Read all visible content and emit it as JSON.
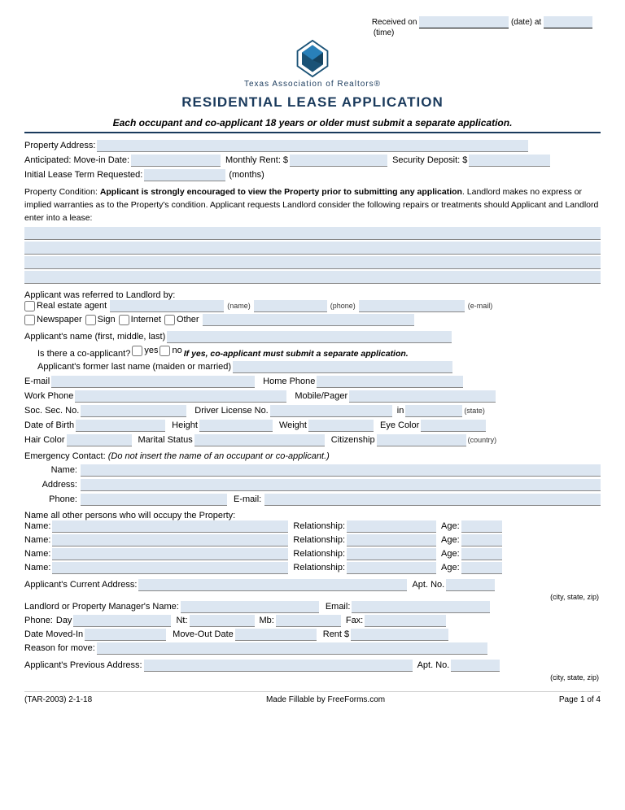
{
  "header": {
    "received_label": "Received on",
    "date_at_label": "(date) at",
    "time_label": "(time)",
    "org_name": "Texas Association of Realtors",
    "org_trademark": "®",
    "form_title": "RESIDENTIAL LEASE APPLICATION",
    "subtitle": "Each occupant and co-applicant 18 years or older must submit a separate application."
  },
  "property_section": {
    "address_label": "Property Address:",
    "move_in_label": "Anticipated:  Move-in Date:",
    "monthly_rent_label": "Monthly Rent: $",
    "security_deposit_label": "Security Deposit: $",
    "lease_term_label": "Initial Lease Term Requested:",
    "lease_term_unit": "(months)"
  },
  "condition_section": {
    "text_start": "Property Condition: ",
    "bold_text": "Applicant is strongly encouraged to view the Property prior to submitting any application",
    "text_end": ". Landlord makes no express or implied warranties as to the Property's condition. Applicant requests Landlord consider the following repairs or treatments should Applicant and Landlord enter into a lease:"
  },
  "referred_section": {
    "label": "Applicant was referred to Landlord by:",
    "real_estate_label": "Real estate agent",
    "name_label": "(name)",
    "phone_label": "(phone)",
    "email_label": "(e-mail)",
    "newspaper_label": "Newspaper",
    "sign_label": "Sign",
    "internet_label": "Internet",
    "other_label": "Other"
  },
  "applicant_section": {
    "name_label": "Applicant's name (first, middle, last)",
    "co_applicant_label": "Is there a co-applicant?",
    "yes_label": "yes",
    "no_label": "no",
    "co_note": "If yes, co-applicant must submit a separate application.",
    "former_name_label": "Applicant's former last name (maiden or married)",
    "email_label": "E-mail",
    "home_phone_label": "Home Phone",
    "work_phone_label": "Work Phone",
    "mobile_label": "Mobile/Pager",
    "soc_sec_label": "Soc. Sec. No.",
    "driver_license_label": "Driver License No.",
    "in_label": "in",
    "state_label": "(state)",
    "dob_label": "Date of Birth",
    "height_label": "Height",
    "weight_label": "Weight",
    "eye_color_label": "Eye Color",
    "hair_color_label": "Hair Color",
    "marital_status_label": "Marital Status",
    "citizenship_label": "Citizenship",
    "country_label": "(country)"
  },
  "emergency_section": {
    "label": "Emergency Contact:",
    "note": "(Do not insert the name of an occupant or co-applicant.)",
    "name_label": "Name:",
    "address_label": "Address:",
    "phone_label": "Phone:",
    "email_label": "E-mail:"
  },
  "occupants_section": {
    "label": "Name all other persons who will occupy the Property:",
    "rows": [
      {
        "name_label": "Name:",
        "rel_label": "Relationship:",
        "age_label": "Age:"
      },
      {
        "name_label": "Name:",
        "rel_label": "Relationship:",
        "age_label": "Age:"
      },
      {
        "name_label": "Name:",
        "rel_label": "Relationship:",
        "age_label": "Age:"
      },
      {
        "name_label": "Name:",
        "rel_label": "Relationship:",
        "age_label": "Age:"
      }
    ]
  },
  "current_address_section": {
    "label": "Applicant's Current Address:",
    "apt_label": "Apt. No.",
    "city_state_zip_label": "(city, state, zip)",
    "landlord_label": "Landlord or Property Manager's Name:",
    "email_label": "Email:",
    "phone_label": "Phone:",
    "day_label": "Day",
    "nt_label": "Nt:",
    "mb_label": "Mb:",
    "fax_label": "Fax:",
    "moved_in_label": "Date Moved-In",
    "move_out_label": "Move-Out Date",
    "rent_label": "Rent $",
    "reason_label": "Reason for move:"
  },
  "previous_address_section": {
    "label": "Applicant's Previous Address:",
    "apt_label": "Apt. No.",
    "city_state_zip_label": "(city, state, zip)"
  },
  "footer": {
    "form_code": "(TAR-2003) 2-1-18",
    "fillable_by": "Made Fillable by FreeForms.com",
    "page_label": "Page 1 of 4"
  }
}
